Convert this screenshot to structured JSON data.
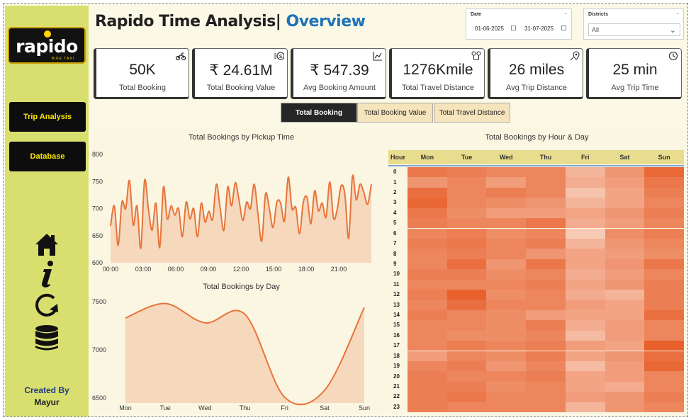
{
  "app": {
    "title_main": "Rapido Time Analysis|",
    "title_accent": "Overview",
    "logo_text": "rapido",
    "logo_sub": "BIKE TAXI"
  },
  "sidebar": {
    "buttons": [
      {
        "label": "Trip Analysis"
      },
      {
        "label": "Database"
      }
    ],
    "icons": [
      "home-icon",
      "info-icon",
      "refresh-icon",
      "database-icon"
    ],
    "created_by_label": "Created By",
    "author": "Mayur"
  },
  "filters": {
    "date_label": "Date",
    "date_from": "01-06-2025",
    "date_to": "31-07-2025",
    "districts_label": "Districts",
    "districts_value": "All"
  },
  "kpis": [
    {
      "value": "50K",
      "caption": "Total Booking",
      "icon": "motorbike-icon"
    },
    {
      "value": "₹ 24.61M",
      "caption": "Total Booking Value",
      "icon": "money-icon"
    },
    {
      "value": "₹ 547.39",
      "caption": "Avg Booking Amount",
      "icon": "line-chart-icon"
    },
    {
      "value": "1276Kmile",
      "caption": "Total Travel Distance",
      "icon": "route-pins-icon"
    },
    {
      "value": "26 miles",
      "caption": "Avg Trip Distance",
      "icon": "map-pin-icon"
    },
    {
      "value": "25 min",
      "caption": "Avg Trip Time",
      "icon": "clock-icon"
    }
  ],
  "tabs": [
    {
      "label": "Total Booking",
      "active": true
    },
    {
      "label": "Total Booking Value",
      "active": false
    },
    {
      "label": "Total Travel Distance",
      "active": false
    }
  ],
  "colors": {
    "accent": "#1f72b8",
    "line": "#e8743b",
    "area": "#f6d8bd",
    "sidebar": "#d8df6f",
    "nav_text": "#ffe600",
    "heat_low": "#f8d2c0",
    "heat_high": "#e8602c"
  },
  "chart_data": [
    {
      "type": "area",
      "title": "Total Bookings by Pickup Time",
      "ylim": [
        600,
        800
      ],
      "yticks": [
        600,
        650,
        700,
        750,
        800
      ],
      "xticks": [
        "00:00",
        "03:00",
        "06:00",
        "09:00",
        "12:00",
        "15:00",
        "18:00",
        "21:00"
      ],
      "x_domain": [
        0,
        24
      ],
      "values": [
        668,
        705,
        632,
        712,
        700,
        752,
        670,
        705,
        627,
        752,
        700,
        660,
        710,
        628,
        740,
        681,
        705,
        688,
        700,
        648,
        712,
        681,
        700,
        648,
        710,
        675,
        695,
        680,
        745,
        700,
        660,
        740,
        705,
        748,
        715,
        678,
        712,
        700,
        745,
        690,
        640,
        727,
        700,
        665,
        712,
        710,
        677,
        758,
        700,
        702,
        654,
        712,
        720,
        672,
        733,
        696,
        710,
        684,
        749,
        682,
        700,
        742,
        726,
        645,
        760,
        716,
        745,
        730,
        708,
        745
      ],
      "grid": false
    },
    {
      "type": "area",
      "title": "Total Bookings by Day",
      "categories": [
        "Mon",
        "Tue",
        "Wed",
        "Thu",
        "Fri",
        "Sat",
        "Sun"
      ],
      "values": [
        7330,
        7480,
        7280,
        7370,
        6510,
        6580,
        7440
      ],
      "ylim": [
        6450,
        7550
      ],
      "yticks": [
        6500,
        7000,
        7500
      ],
      "grid": false
    },
    {
      "type": "heatmap",
      "title": "Total Bookings by Hour & Day",
      "corner_label": "Hour",
      "columns": [
        "Mon",
        "Tue",
        "Wed",
        "Thu",
        "Fri",
        "Sat",
        "Sun"
      ],
      "rows": [
        "0",
        "1",
        "2",
        "3",
        "4",
        "5",
        "6",
        "7",
        "8",
        "9",
        "10",
        "11",
        "12",
        "13",
        "14",
        "15",
        "16",
        "17",
        "18",
        "19",
        "20",
        "21",
        "22",
        "23"
      ],
      "values": [
        [
          310,
          305,
          300,
          300,
          270,
          290,
          320
        ],
        [
          290,
          300,
          285,
          300,
          275,
          285,
          310
        ],
        [
          315,
          300,
          305,
          300,
          260,
          280,
          305
        ],
        [
          320,
          300,
          295,
          290,
          270,
          280,
          300
        ],
        [
          310,
          295,
          285,
          285,
          280,
          290,
          305
        ],
        [
          305,
          300,
          300,
          310,
          275,
          285,
          300
        ],
        [
          300,
          305,
          295,
          300,
          255,
          295,
          305
        ],
        [
          305,
          310,
          300,
          305,
          270,
          290,
          300
        ],
        [
          300,
          305,
          300,
          290,
          280,
          285,
          295
        ],
        [
          300,
          315,
          290,
          310,
          280,
          290,
          310
        ],
        [
          305,
          305,
          295,
          300,
          275,
          285,
          300
        ],
        [
          300,
          300,
          300,
          305,
          280,
          290,
          305
        ],
        [
          305,
          325,
          295,
          300,
          275,
          270,
          305
        ],
        [
          300,
          315,
          300,
          300,
          285,
          280,
          305
        ],
        [
          305,
          300,
          295,
          285,
          280,
          280,
          315
        ],
        [
          300,
          300,
          295,
          305,
          275,
          285,
          300
        ],
        [
          300,
          295,
          295,
          300,
          265,
          285,
          300
        ],
        [
          300,
          305,
          300,
          305,
          285,
          280,
          325
        ],
        [
          285,
          300,
          295,
          305,
          280,
          290,
          315
        ],
        [
          300,
          305,
          290,
          300,
          265,
          285,
          320
        ],
        [
          305,
          300,
          300,
          305,
          280,
          285,
          300
        ],
        [
          305,
          305,
          295,
          300,
          280,
          275,
          300
        ],
        [
          305,
          310,
          300,
          300,
          285,
          290,
          305
        ],
        [
          305,
          300,
          300,
          300,
          270,
          290,
          300
        ]
      ],
      "vmin": 250,
      "vmax": 325
    }
  ]
}
